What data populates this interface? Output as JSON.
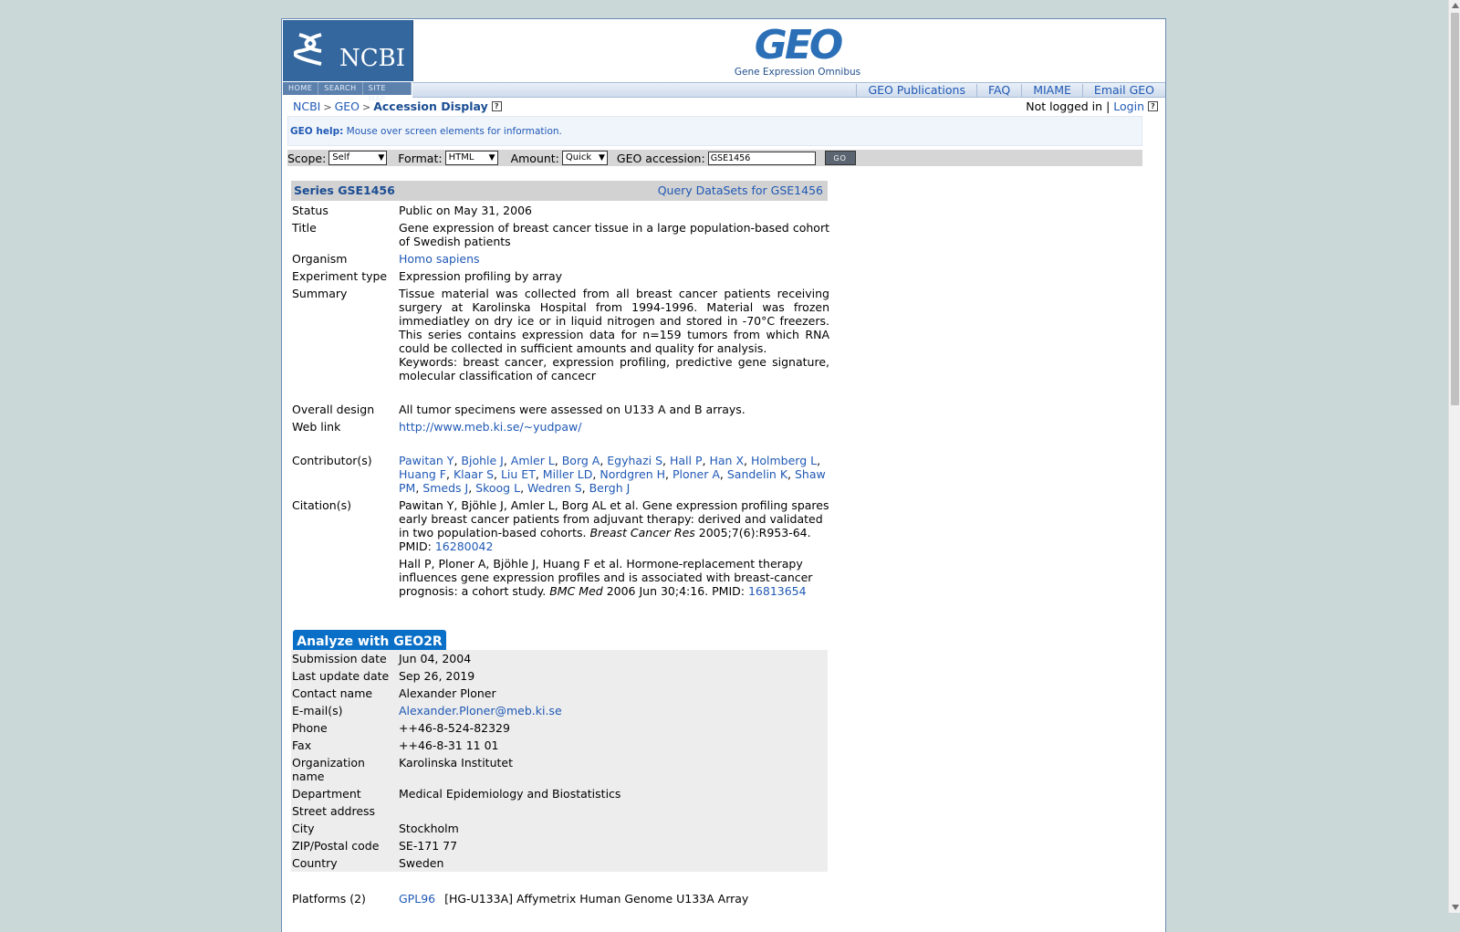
{
  "header": {
    "ncbi_logo_text": "NCBI",
    "geo_logo_text": "GEO",
    "geo_tagline": "Gene Expression Omnibus",
    "ncbi_nav": [
      "HOME",
      "SEARCH",
      "SITE MAP"
    ],
    "top_links": [
      "GEO Publications",
      "FAQ",
      "MIAME",
      "Email GEO"
    ]
  },
  "breadcrumb": {
    "items": [
      "NCBI",
      "GEO"
    ],
    "separator": ">",
    "current": "Accession Display"
  },
  "login": {
    "status": "Not logged in",
    "divider": "|",
    "link": "Login"
  },
  "help": {
    "label": "GEO help:",
    "text": "Mouse over screen elements for information."
  },
  "search": {
    "scope_label": "Scope:",
    "scope_value": "Self",
    "format_label": "Format:",
    "format_value": "HTML",
    "amount_label": "Amount:",
    "amount_value": "Quick",
    "accession_label": "GEO accession:",
    "accession_value": "GSE1456",
    "go_label": "GO"
  },
  "series": {
    "title": "Series GSE1456",
    "query_link": "Query DataSets for GSE1456"
  },
  "fields": [
    {
      "label": "Status",
      "value": "Public on May 31, 2006"
    },
    {
      "label": "Title",
      "value": "Gene expression of breast cancer tissue in a large population-based cohort of Swedish patients"
    },
    {
      "label": "Organism",
      "value": "Homo sapiens"
    },
    {
      "label": "Experiment type",
      "value": "Expression profiling by array"
    },
    {
      "label": "Summary",
      "value": "Tissue material was collected from all breast cancer patients receiving surgery at Karolinska Hospital from 1994-1996. Material was frozen immediatley on dry ice or in liquid nitrogen and stored in -70°C freezers. This series contains expression data for n=159 tumors from which RNA could be collected in sufficient amounts and quality for analysis.",
      "extra": "Keywords: breast cancer, expression profiling, predictive gene signature, molecular classification of cancecr"
    },
    {
      "label": "Overall design",
      "value": "All tumor specimens were assessed on U133 A and B arrays."
    },
    {
      "label": "Web link",
      "value": "http://www.meb.ki.se/~yudpaw/"
    },
    {
      "label": "Contributor(s)",
      "value": ""
    },
    {
      "label": "Citation(s)",
      "value": ""
    }
  ],
  "contributors": [
    "Pawitan Y",
    "Bjohle J",
    "Amler L",
    "Borg A",
    "Egyhazi S",
    "Hall P",
    "Han X",
    "Holmberg L",
    "Huang F",
    "Klaar S",
    "Liu ET",
    "Miller LD",
    "Nordgren H",
    "Ploner A",
    "Sandelin K",
    "Shaw PM",
    "Smeds J",
    "Skoog L",
    "Wedren S",
    "Bergh J"
  ],
  "citations": [
    {
      "text": "Pawitan Y, Bjöhle J, Amler L, Borg AL et al. Gene expression profiling spares early breast cancer patients from adjuvant therapy: derived and validated in two population-based cohorts.",
      "journal": "Breast Cancer Res",
      "ref": "2005;7(6):R953-64.",
      "pmid_label": "PMID:",
      "pmid": "16280042"
    },
    {
      "text": "Hall P, Ploner A, Bjöhle J, Huang F et al. Hormone-replacement therapy influences gene expression profiles and is associated with breast-cancer prognosis: a cohort study.",
      "journal": "BMC Med",
      "ref": "2006 Jun 30;4:16.",
      "pmid_label": "PMID:",
      "pmid": "16813654"
    }
  ],
  "geo2r_button": "Analyze with GEO2R",
  "contact": [
    {
      "label": "Submission date",
      "value": "Jun 04, 2004"
    },
    {
      "label": "Last update date",
      "value": "Sep 26, 2019"
    },
    {
      "label": "Contact name",
      "value": "Alexander Ploner"
    },
    {
      "label": "E-mail(s)",
      "value": "Alexander.Ploner@meb.ki.se"
    },
    {
      "label": "Phone",
      "value": "++46-8-524-82329"
    },
    {
      "label": "Fax",
      "value": "++46-8-31 11 01"
    },
    {
      "label": "Organization name",
      "value": "Karolinska Institutet"
    },
    {
      "label": "Department",
      "value": "Medical Epidemiology and Biostatistics"
    },
    {
      "label": "Street address",
      "value": ""
    },
    {
      "label": "City",
      "value": "Stockholm"
    },
    {
      "label": "ZIP/Postal code",
      "value": "SE-171 77"
    },
    {
      "label": "Country",
      "value": "Sweden"
    }
  ],
  "platforms": {
    "label": "Platforms (2)",
    "items": [
      {
        "id": "GPL96",
        "desc": "[HG-U133A] Affymetrix Human Genome U133A Array"
      }
    ]
  },
  "colors": {
    "page_bg": "#cbd8d8",
    "link": "#2059b5",
    "ncbi_blue": "#33679e",
    "geo2r_button": "#0a6fc7"
  }
}
